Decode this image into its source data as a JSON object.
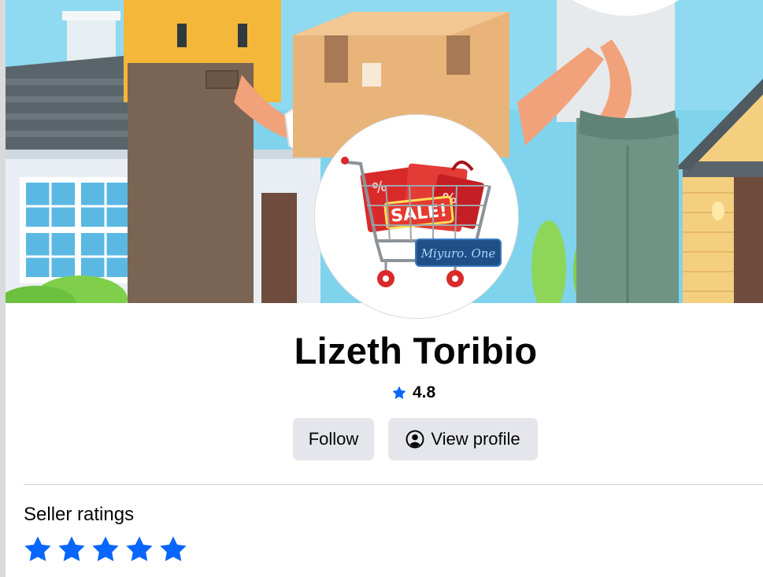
{
  "cover": {
    "image_description_icon": "delivery-cover-image"
  },
  "avatar": {
    "sale_text": "SALE!",
    "brand_text": "Miyuro. One"
  },
  "seller": {
    "name": "Lizeth Toribio",
    "rating": "4.8"
  },
  "buttons": {
    "follow_label": "Follow",
    "view_profile_label": "View profile"
  },
  "ratings_section": {
    "title": "Seller ratings",
    "stars": 5
  },
  "colors": {
    "accent_blue": "#0866ff",
    "button_bg": "#e4e6eb",
    "text_primary": "#050505",
    "divider": "#ced0d4"
  }
}
